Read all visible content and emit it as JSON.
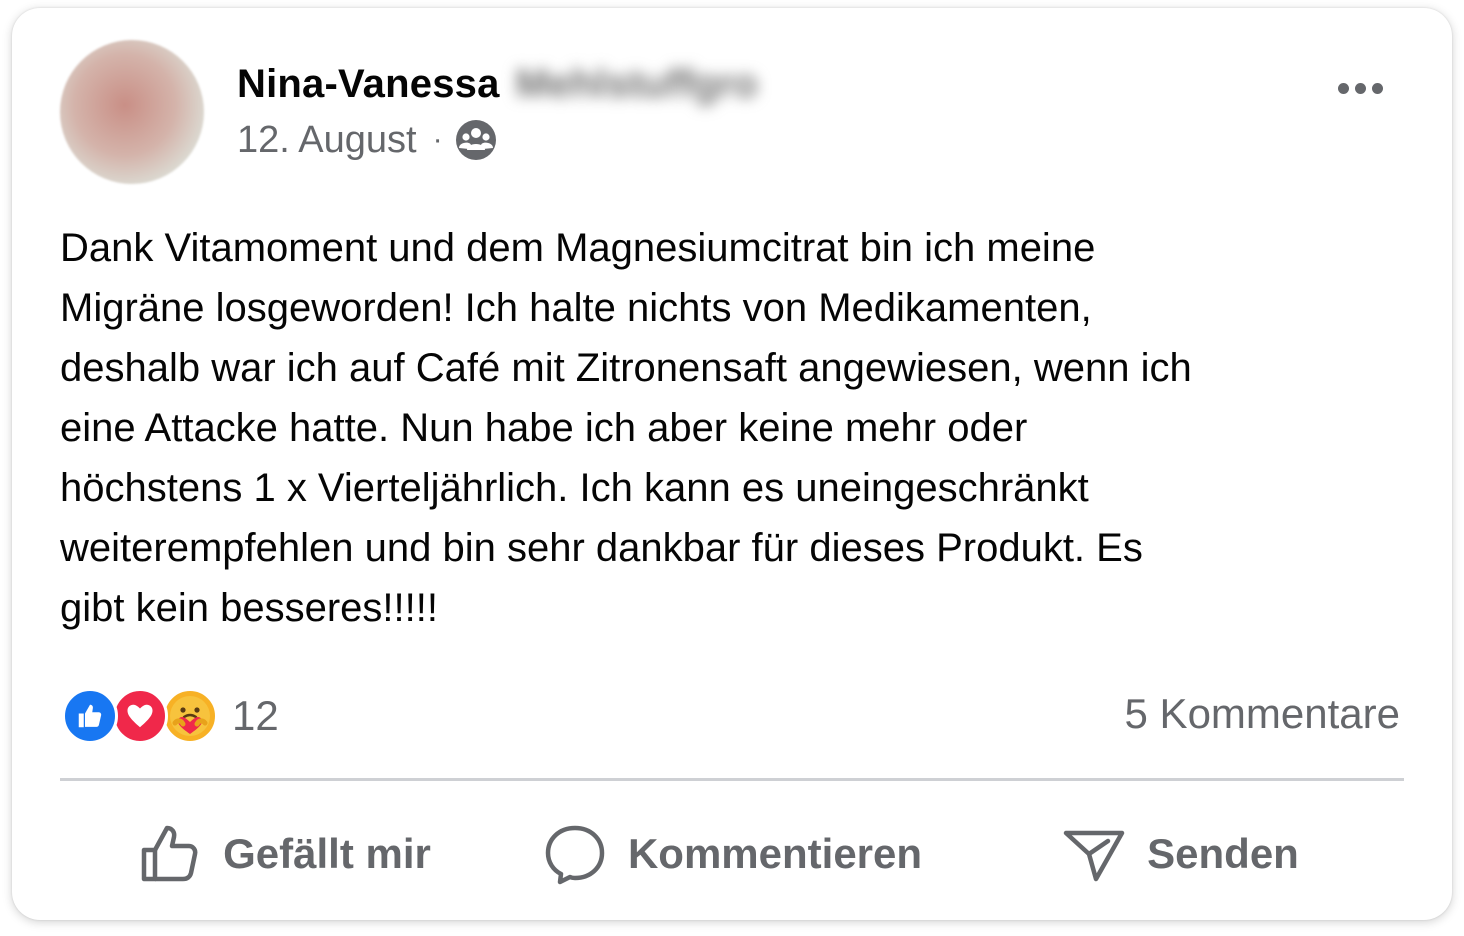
{
  "post": {
    "author": {
      "name": "Nina-Vanessa",
      "surname": "Mehlstuffgro"
    },
    "date": "12. August",
    "meta_separator": "·",
    "audience_icon": "group-icon",
    "text": "Dank Vitamoment und dem Magnesiumcitrat bin ich meine\nMigräne losgeworden! Ich halte nichts von Medikamenten,\ndeshalb war ich auf Café mit Zitronensaft angewiesen, wenn ich\neine Attacke hatte. Nun habe ich aber keine mehr oder\nhöchstens 1 x Vierteljährlich. Ich kann es uneingeschränkt\nweiterempfehlen und bin sehr dankbar für dieses Produkt. Es\ngibt kein besseres!!!!!",
    "reactions": {
      "icons": [
        "like-icon",
        "love-icon",
        "care-icon"
      ],
      "count": "12"
    },
    "comments_count": "5 Kommentare"
  },
  "actions": {
    "like": "Gefällt mir",
    "comment": "Kommentieren",
    "share": "Senden"
  },
  "colors": {
    "like": "#1877f2",
    "love": "#f0284a",
    "care": "#f7b125",
    "secondary_text": "#65676b",
    "primary_text": "#050505"
  }
}
